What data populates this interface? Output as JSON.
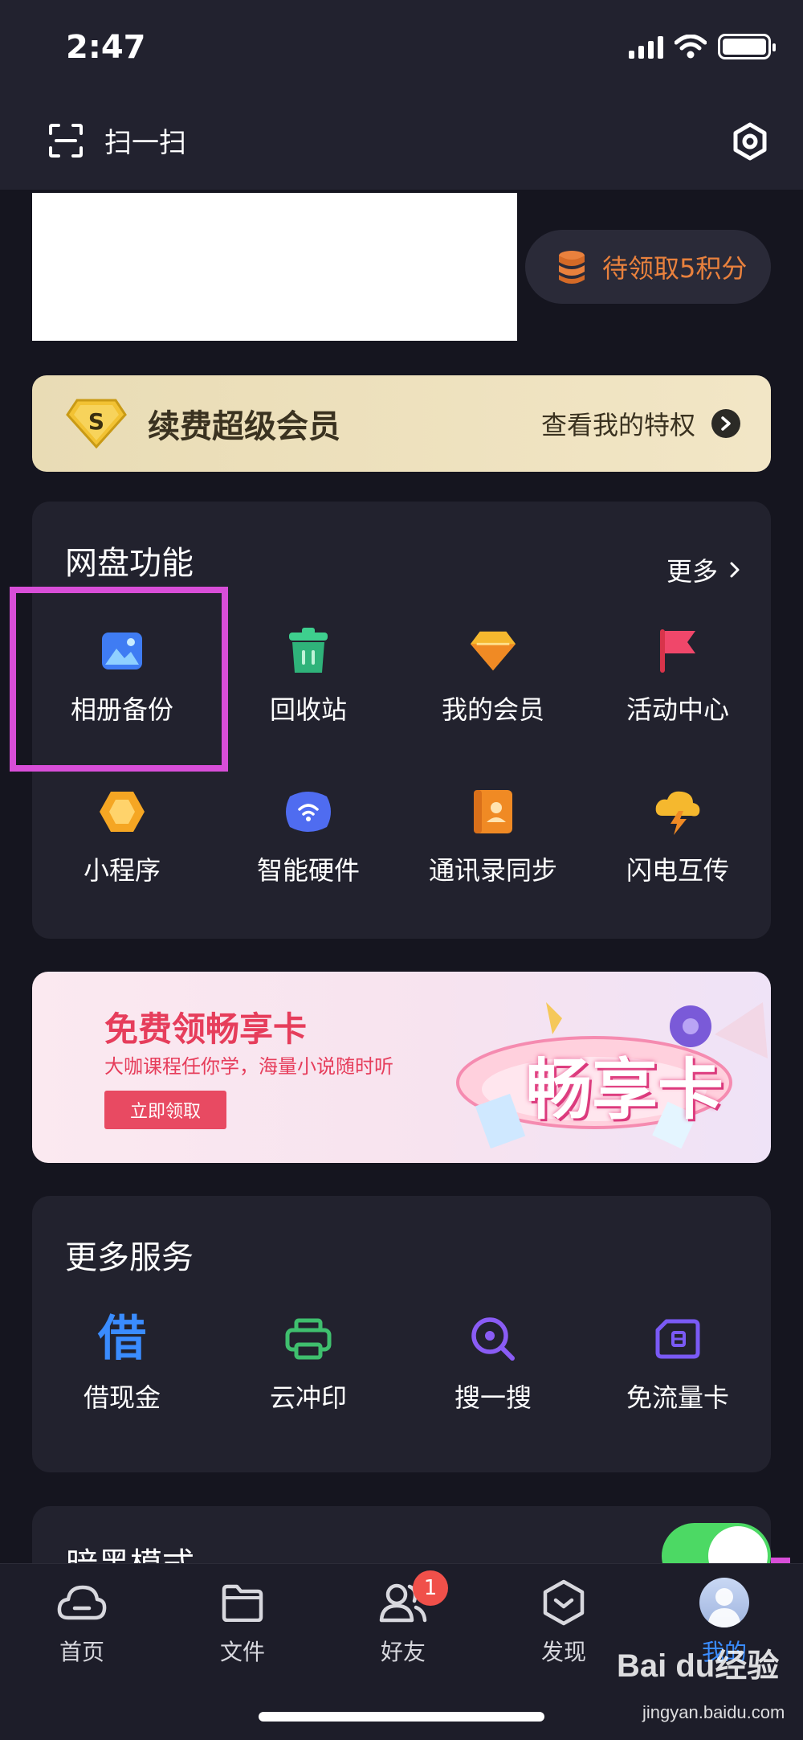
{
  "status_bar": {
    "time": "2:47"
  },
  "header": {
    "scan_label": "扫一扫"
  },
  "points": {
    "label": "待领取5积分"
  },
  "vip_banner": {
    "title": "续费超级会员",
    "link": "查看我的特权",
    "badge_letter": "S"
  },
  "netdisk": {
    "title": "网盘功能",
    "more": "更多",
    "items": [
      {
        "label": "相册备份",
        "icon": "album-icon"
      },
      {
        "label": "回收站",
        "icon": "trash-icon"
      },
      {
        "label": "我的会员",
        "icon": "gem-icon"
      },
      {
        "label": "活动中心",
        "icon": "flag-icon"
      },
      {
        "label": "小程序",
        "icon": "mini-program-icon"
      },
      {
        "label": "智能硬件",
        "icon": "smart-device-icon"
      },
      {
        "label": "通讯录同步",
        "icon": "contacts-icon"
      },
      {
        "label": "闪电互传",
        "icon": "lightning-icon"
      }
    ]
  },
  "promo": {
    "title": "免费领畅享卡",
    "subtitle": "大咖课程任你学，海量小说随时听",
    "button": "立即领取",
    "art_label": "畅享卡"
  },
  "more_services": {
    "title": "更多服务",
    "items": [
      {
        "label": "借现金",
        "glyph": "借",
        "color": "#3a8cff"
      },
      {
        "label": "云冲印",
        "icon": "printer-icon",
        "color": "#3fbf6e"
      },
      {
        "label": "搜一搜",
        "icon": "search-icon",
        "color": "#8a5cf5"
      },
      {
        "label": "免流量卡",
        "icon": "sim-card-icon",
        "color": "#7a5af5"
      }
    ]
  },
  "dark_mode": {
    "label": "暗黑模式",
    "enabled": true
  },
  "tabbar": {
    "items": [
      {
        "label": "首页",
        "icon": "cloud-icon"
      },
      {
        "label": "文件",
        "icon": "folder-icon"
      },
      {
        "label": "好友",
        "icon": "friends-icon",
        "badge": "1"
      },
      {
        "label": "发现",
        "icon": "discover-icon"
      },
      {
        "label": "我的",
        "icon": "profile-avatar",
        "active": true
      }
    ]
  },
  "watermark": {
    "brand": "Bai du经验",
    "url": "jingyan.baidu.com"
  },
  "colors": {
    "accent": "#3a8cff",
    "highlight": "#d84ed8",
    "points": "#e9813d",
    "promo_red": "#e63d5b"
  }
}
